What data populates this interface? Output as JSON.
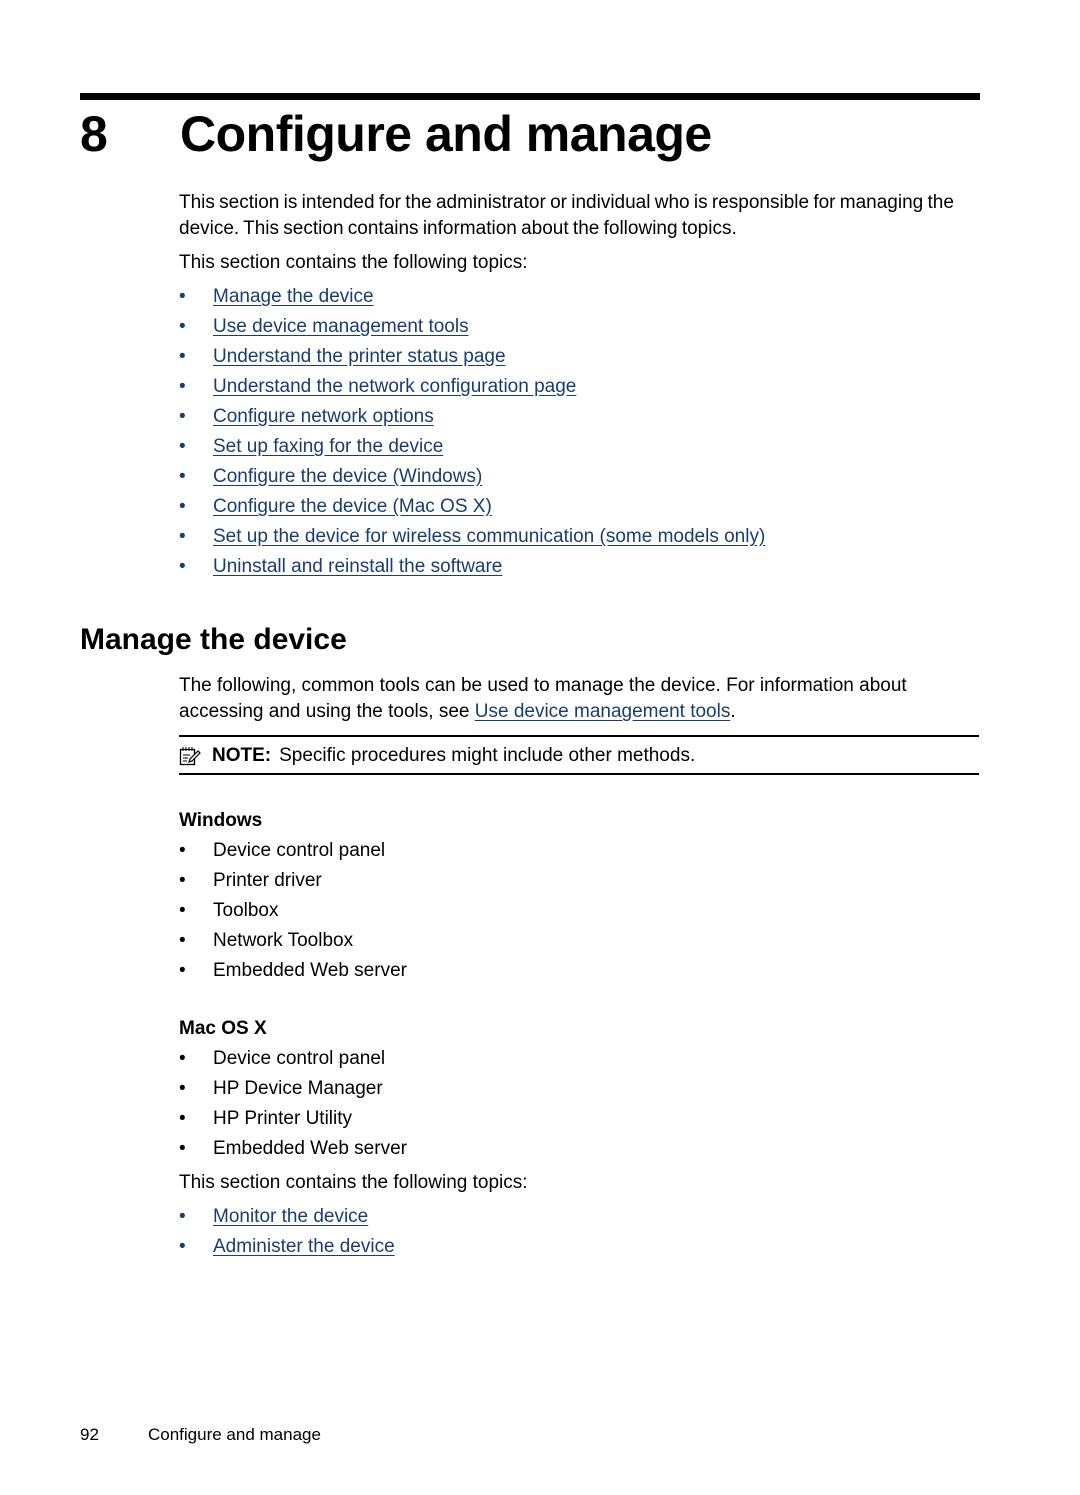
{
  "chapter": {
    "number": "8",
    "title": "Configure and manage"
  },
  "intro": {
    "paragraph": "This section is intended for the administrator or individual who is responsible for managing the device. This section contains information about the following topics.",
    "topics_lead": "This section contains the following topics:",
    "topics": [
      "Manage the device",
      "Use device management tools",
      "Understand the printer status page",
      "Understand the network configuration page",
      "Configure network options",
      "Set up faxing for the device",
      "Configure the device (Windows)",
      "Configure the device (Mac OS X)",
      "Set up the device for wireless communication (some models only)",
      "Uninstall and reinstall the software"
    ]
  },
  "manage_section": {
    "heading": "Manage the device",
    "paragraph_before_link": "The following, common tools can be used to manage the device. For information about accessing and using the tools, see ",
    "paragraph_link": "Use device management tools",
    "paragraph_after_link": ".",
    "note": {
      "icon": "note-pencil-icon",
      "label": "NOTE:",
      "text": "Specific procedures might include other methods."
    },
    "windows": {
      "heading": "Windows",
      "items": [
        "Device control panel",
        "Printer driver",
        "Toolbox",
        "Network Toolbox",
        "Embedded Web server"
      ]
    },
    "mac": {
      "heading": "Mac OS X",
      "items": [
        "Device control panel",
        "HP Device Manager",
        "HP Printer Utility",
        "Embedded Web server"
      ]
    },
    "topics_lead": "This section contains the following topics:",
    "topics": [
      "Monitor the device",
      "Administer the device"
    ]
  },
  "footer": {
    "page_number": "92",
    "chapter_title": "Configure and manage"
  },
  "colors": {
    "link": "#1a3d6e",
    "text": "#000000"
  },
  "bullet_char": "•"
}
